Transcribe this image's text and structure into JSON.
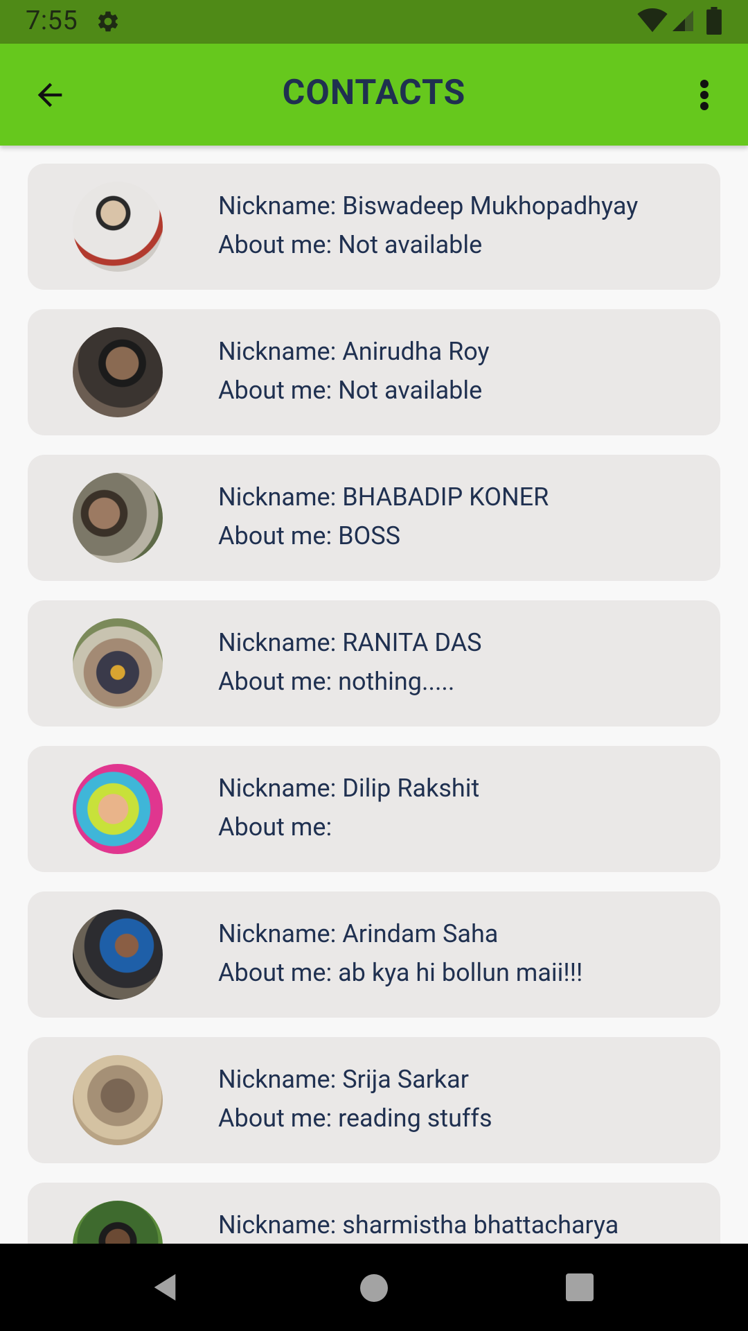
{
  "status_bar": {
    "time": "7:55",
    "icons": [
      "settings-icon",
      "wifi-icon",
      "cell-signal-icon",
      "battery-icon"
    ]
  },
  "app_bar": {
    "title": "CONTACTS",
    "back_icon": "arrow-back-icon",
    "menu_icon": "more-vert-icon"
  },
  "colors": {
    "status_bar": "#4f8a17",
    "app_bar": "#66c81d",
    "card": "#eae8e7",
    "text": "#1f3050",
    "nav_bar": "#000000"
  },
  "contacts": [
    {
      "nickname": "Nickname: Biswadeep Mukhopadhyay",
      "about": "About me: Not available"
    },
    {
      "nickname": "Nickname: Anirudha Roy",
      "about": "About me: Not available"
    },
    {
      "nickname": "Nickname: BHABADIP KONER",
      "about": "About me: BOSS"
    },
    {
      "nickname": "Nickname: RANITA DAS",
      "about": "About me: nothing....."
    },
    {
      "nickname": "Nickname: Dilip Rakshit",
      "about": "About me:"
    },
    {
      "nickname": "Nickname: Arindam Saha",
      "about": "About me: ab kya hi bollun maii!!!"
    },
    {
      "nickname": "Nickname: Srija Sarkar",
      "about": "About me: reading stuffs"
    },
    {
      "nickname": "Nickname: sharmistha bhattacharya",
      "about": ""
    }
  ],
  "nav_bar": {
    "icons": [
      "nav-back-icon",
      "nav-home-icon",
      "nav-recents-icon"
    ]
  }
}
